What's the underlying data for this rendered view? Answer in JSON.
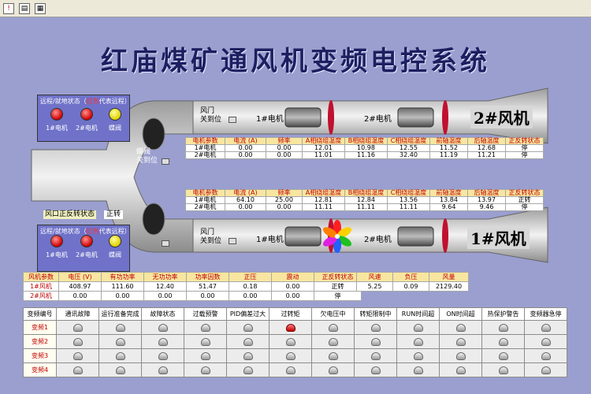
{
  "toolbar": {
    "icons": [
      "stop-icon",
      "print-icon",
      "export-icon"
    ]
  },
  "title": "红庙煤矿通风机变频电控系统",
  "status_panel_top": {
    "header_a": "远程/就地状态（",
    "header_red": "红色",
    "header_b": "代表远程）",
    "lamps": [
      {
        "label": "1#电机",
        "color": "red"
      },
      {
        "label": "2#电机",
        "color": "red"
      },
      {
        "label": "蝶阀",
        "color": "yellow"
      }
    ]
  },
  "status_panel_bottom": {
    "header_a": "远程/就地状态（",
    "header_red": "红色",
    "header_b": "代表远程）",
    "lamps": [
      {
        "label": "1#电机",
        "color": "red"
      },
      {
        "label": "2#电机",
        "color": "red"
      },
      {
        "label": "蝶阀",
        "color": "yellow"
      }
    ]
  },
  "fans": {
    "upper": {
      "name": "2#风机",
      "motor1": "1#电机",
      "motor2": "2#电机",
      "gate": "风门",
      "gate_state": "关到位"
    },
    "lower": {
      "name": "1#风机",
      "motor1": "1#电机",
      "motor2": "2#电机",
      "gate": "风门",
      "gate_state": "关到位"
    },
    "butterfly": {
      "label1": "蝶阀",
      "label2": "关到位"
    },
    "airgate_status": "风口正反转状态",
    "airgate_value": "正转"
  },
  "table_upper": {
    "headers": [
      "电机参数",
      "电流 (A)",
      "频率",
      "A相绕组温度",
      "B相绕组温度",
      "C相绕组温度",
      "前轴温度",
      "后轴温度",
      "正反转状态"
    ],
    "rows": [
      [
        "1#电机",
        "0.00",
        "0.00",
        "12.01",
        "10.98",
        "12.55",
        "11.52",
        "12.68",
        "停"
      ],
      [
        "2#电机",
        "0.00",
        "0.00",
        "11.01",
        "11.16",
        "32.40",
        "11.19",
        "11.21",
        "停"
      ]
    ]
  },
  "table_lower": {
    "headers": [
      "电机参数",
      "电流 (A)",
      "频率",
      "A相绕组温度",
      "B相绕组温度",
      "C相绕组温度",
      "前轴温度",
      "后轴温度",
      "正反转状态"
    ],
    "rows": [
      [
        "1#电机",
        "64.10",
        "25.00",
        "12.81",
        "12.84",
        "13.56",
        "13.84",
        "13.97",
        "正转"
      ],
      [
        "2#电机",
        "0.00",
        "0.00",
        "11.11",
        "11.11",
        "11.11",
        "9.64",
        "9.46",
        "停"
      ]
    ]
  },
  "table_fan": {
    "headers": [
      "风机参数",
      "电压 (V)",
      "有功功率",
      "无功功率",
      "功率因数",
      "正压",
      "震动",
      "正反转状态"
    ],
    "rows": [
      [
        "1#风机",
        "408.97",
        "111.60",
        "12.40",
        "51.47",
        "0.18",
        "0.00",
        "正转"
      ],
      [
        "2#风机",
        "0.00",
        "0.00",
        "0.00",
        "0.00",
        "0.00",
        "0.00",
        "停"
      ]
    ]
  },
  "table_air": {
    "headers": [
      "风速",
      "负压",
      "风量"
    ],
    "rows": [
      [
        "5.25",
        "0.09",
        "2129.40"
      ]
    ]
  },
  "fault_grid": {
    "headers": [
      "变频编号",
      "通讯故障",
      "运行准备完成",
      "故障状态",
      "过载预警",
      "PID偏差过大",
      "过转矩",
      "欠电压中",
      "转矩限制中",
      "RUN时间超",
      "ON时间超",
      "热保护警告",
      "变频器急停"
    ],
    "rows": [
      {
        "name": "变频1",
        "on": [
          5
        ]
      },
      {
        "name": "变频2",
        "on": []
      },
      {
        "name": "变频3",
        "on": []
      },
      {
        "name": "变频4",
        "on": []
      }
    ]
  }
}
